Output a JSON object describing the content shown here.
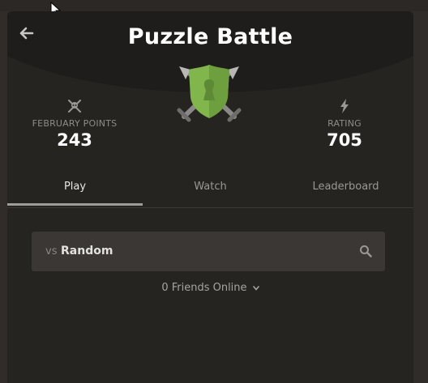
{
  "header": {
    "title": "Puzzle Battle",
    "back_icon": "arrow-left-icon",
    "emblem_icon": "shield-crossed-swords-icon"
  },
  "stats": {
    "points": {
      "icon": "crossed-swords-skull-icon",
      "label": "FEBRUARY POINTS",
      "value": "243"
    },
    "rating": {
      "icon": "lightning-bolt-icon",
      "label": "RATING",
      "value": "705"
    }
  },
  "tabs": [
    {
      "label": "Play",
      "active": true
    },
    {
      "label": "Watch",
      "active": false
    },
    {
      "label": "Leaderboard",
      "active": false
    }
  ],
  "search": {
    "prefix": "vs",
    "value": "Random",
    "icon": "search-icon"
  },
  "friends": {
    "label": "0 Friends Online",
    "icon": "chevron-down-icon"
  },
  "colors": {
    "background": "#2f2c29",
    "panel": "#262421",
    "header": "#1f1d1b",
    "shield_green": "#81b64c",
    "text_primary": "#ffffff",
    "text_muted": "#9a9794"
  }
}
